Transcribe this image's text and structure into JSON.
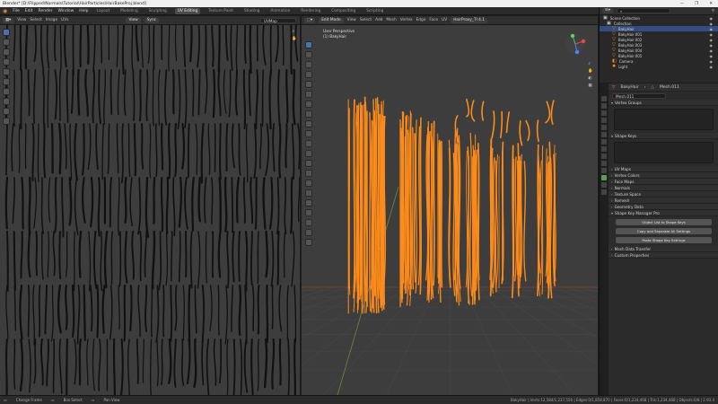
{
  "window": {
    "title": "Blender* [D:\\Flipped\\Normals\\Tutorial\\HairParticles\\HairBakeProj.blend]",
    "controls": [
      "—",
      "❐",
      "✕"
    ]
  },
  "menubar": {
    "items": [
      "File",
      "Edit",
      "Render",
      "Window",
      "Help"
    ],
    "workspaces": [
      "Layout",
      "Modeling",
      "Sculpting",
      "UV Editing",
      "Texture Paint",
      "Shading",
      "Animation",
      "Rendering",
      "Compositing",
      "Scripting"
    ],
    "active_workspace": "UV Editing",
    "scene_label": "Scene",
    "view_layer_label": "View Layer"
  },
  "uv_editor": {
    "header_items": [
      "View",
      "Select",
      "Image",
      "UVs"
    ],
    "mode": "View",
    "uvmap_label": "UVMap",
    "sync_label": "Sync"
  },
  "view3d": {
    "mode": "Edit Mode",
    "header_items": [
      "View",
      "Select",
      "Add",
      "Mesh",
      "Vertex",
      "Edge",
      "Face",
      "UV"
    ],
    "orientation": "Global",
    "perspective_label": "User Perspective",
    "object_label": "(1) BakyHair",
    "shading_dropdown": "HairProxy_Tl 4.1"
  },
  "outliner": {
    "search_placeholder": "",
    "rows": [
      {
        "label": "Scene Collection",
        "selected": false
      },
      {
        "label": "Collection",
        "selected": false
      },
      {
        "label": "BakyHair",
        "selected": true
      },
      {
        "label": "BakyHair.001",
        "selected": false
      },
      {
        "label": "BakyHair.002",
        "selected": false
      },
      {
        "label": "BakyHair.003",
        "selected": false
      },
      {
        "label": "BakyHair.004",
        "selected": false
      },
      {
        "label": "BakyHair.005",
        "selected": false
      },
      {
        "label": "Camera",
        "selected": false
      },
      {
        "label": "Light",
        "selected": false
      }
    ]
  },
  "properties": {
    "object_name": "BakyHair",
    "mesh_name": "Mesh.011",
    "data_field": "Mesh.011",
    "panels": [
      {
        "label": "Vertex Groups",
        "open": true
      },
      {
        "label": "Shape Keys",
        "open": true
      },
      {
        "label": "UV Maps",
        "open": false
      },
      {
        "label": "Vertex Colors",
        "open": false
      },
      {
        "label": "Face Maps",
        "open": false
      },
      {
        "label": "Normals",
        "open": false
      },
      {
        "label": "Texture Space",
        "open": false
      },
      {
        "label": "Remesh",
        "open": false
      },
      {
        "label": "Geometry Data",
        "open": false
      },
      {
        "label": "Shape Key Manager Pro",
        "open": true
      }
    ],
    "skm_buttons": [
      "Object List to Shape Keys",
      "Copy and Separate All Settings",
      "Paste Shape Key Settings"
    ],
    "bottom_panels": [
      {
        "label": "Mesh Data Transfer",
        "open": false
      },
      {
        "label": "Custom Properties",
        "open": false
      }
    ]
  },
  "statusbar": {
    "items": [
      "Change Frame",
      "Box Select",
      "Pan View"
    ],
    "stats": "BakyHair | Verts:12,584/1,237,556 | Edges:0/1,858,870 | Faces:0/1,234,468 | Tris:1,234,468 | Objects:0/8 | 2.93.4"
  },
  "colors": {
    "accent": "#4772b3",
    "selection_orange": "#ff8c1a",
    "outliner_select": "#334d80"
  }
}
